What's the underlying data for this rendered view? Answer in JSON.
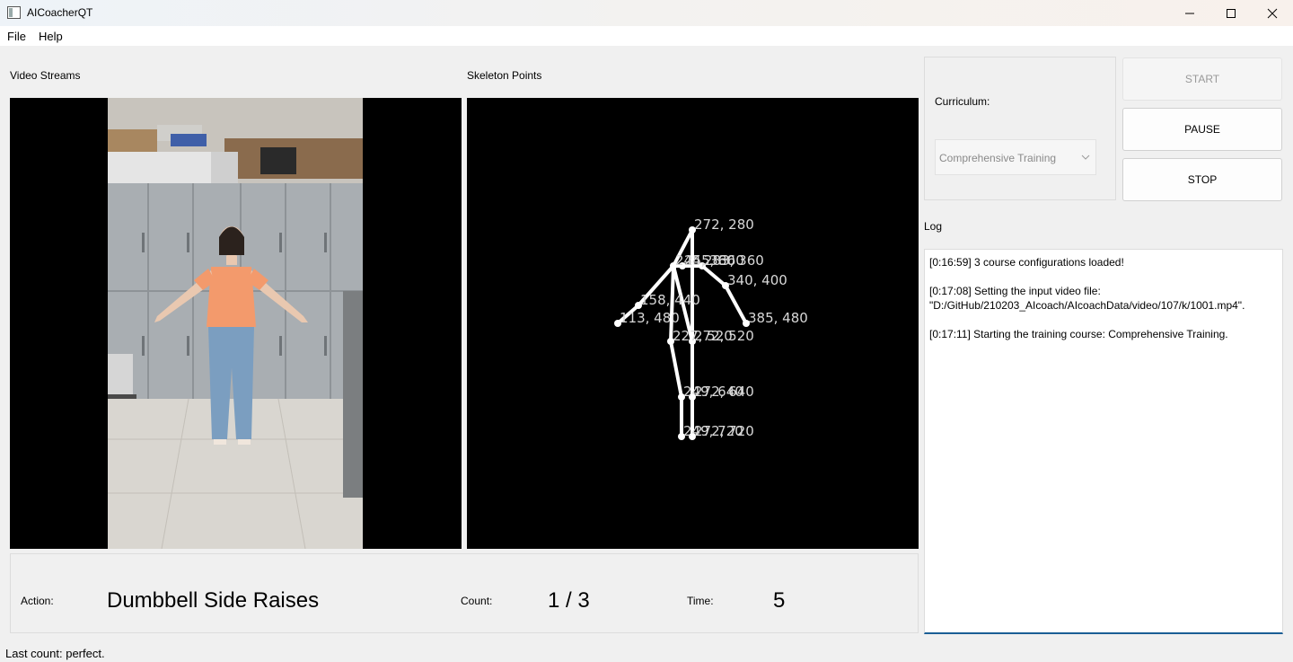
{
  "window": {
    "title": "AICoacherQT"
  },
  "menu": {
    "file": "File",
    "help": "Help"
  },
  "video": {
    "label": "Video Streams"
  },
  "skeleton": {
    "label": "Skeleton Points",
    "points": [
      {
        "id": "head",
        "label": "272, 280"
      },
      {
        "id": "neck",
        "label": "244, 360"
      },
      {
        "id": "neck2",
        "label": "255, 360"
      },
      {
        "id": "r-shoulder",
        "label": "283, 360"
      },
      {
        "id": "l-elbow",
        "label": "158, 440"
      },
      {
        "id": "l-wrist",
        "label": "113, 480"
      },
      {
        "id": "r-elbow",
        "label": "340, 400"
      },
      {
        "id": "r-wrist",
        "label": "385, 480"
      },
      {
        "id": "l-hip",
        "label": "227, 520"
      },
      {
        "id": "r-hip",
        "label": "272, 520"
      },
      {
        "id": "l-knee",
        "label": "249, 640"
      },
      {
        "id": "r-knee",
        "label": "272, 640"
      },
      {
        "id": "l-ankle",
        "label": "249, 720"
      },
      {
        "id": "r-ankle",
        "label": "272, 720"
      }
    ]
  },
  "curriculum": {
    "label": "Curriculum:",
    "selected": "Comprehensive Training"
  },
  "buttons": {
    "start": "START",
    "pause": "PAUSE",
    "stop": "STOP"
  },
  "log": {
    "label": "Log",
    "entries": [
      "[0:16:59] 3 course configurations loaded!",
      "[0:17:08] Setting the input video file: \"D:/GitHub/210203_AIcoach/AIcoachData/video/107/k/1001.mp4\".",
      "[0:17:11] Starting the training course: Comprehensive Training."
    ]
  },
  "status": {
    "action_label": "Action:",
    "action_value": "Dumbbell Side Raises",
    "count_label": "Count:",
    "count_value": "1 / 3",
    "time_label": "Time:",
    "time_value": "5"
  },
  "statusbar": {
    "message": "Last count: perfect."
  }
}
